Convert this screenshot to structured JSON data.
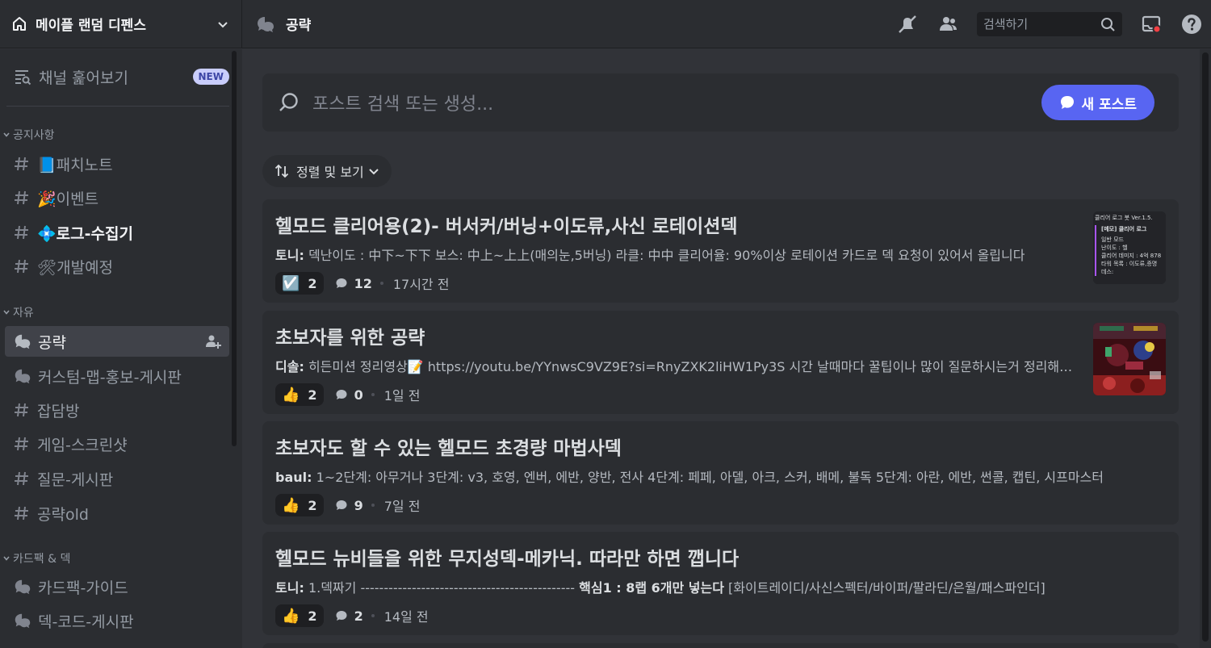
{
  "server": {
    "name": "메이플 랜덤 디펜스"
  },
  "channel": {
    "title": "공략"
  },
  "toolbar": {
    "search_placeholder": "검색하기"
  },
  "sidebar": {
    "browse": {
      "label": "채널 훑어보기",
      "badge": "NEW"
    },
    "categories": [
      {
        "label": "공지사항"
      },
      {
        "label": "자유"
      },
      {
        "label": "카드팩 & 덱"
      }
    ],
    "channels": [
      {
        "label": "📘패치노트"
      },
      {
        "label": "🎉이벤트"
      },
      {
        "label": "💠로그-수집기"
      },
      {
        "label": "🛠개발예정"
      },
      {
        "label": "공략"
      },
      {
        "label": "커스텀-맵-홍보-게시판"
      },
      {
        "label": "잡담방"
      },
      {
        "label": "게임-스크린샷"
      },
      {
        "label": "질문-게시판"
      },
      {
        "label": "공략old"
      },
      {
        "label": "카드팩-가이드"
      },
      {
        "label": "덱-코드-게시판"
      }
    ]
  },
  "main": {
    "search_placeholder": "포스트 검색 또는 생성...",
    "new_post_label": "새 포스트",
    "sort_label": "정렬 및 보기",
    "posts": [
      {
        "title": "헬모드 클리어용(2)- 버서커/버닝+이도류,사신 로테이션덱",
        "author": "토니:",
        "preview": "덱난이도 : 中下~下下 보스: 中上~上上(매의눈,5버닝) 라클: 中中 클리어율: 90%이상 로테이션 카드로 덱 요청이 있어서 올립니다",
        "reaction_emoji": "☑️",
        "reaction_count": "2",
        "message_count": "12",
        "time": "17시간 전",
        "thumb_text": [
          "클리어 로그 봇 Ver.1.5.",
          "[메모] 클리어 로그",
          "일반 모드",
          "난이도 : 헬",
          "클리어 데미지 : 4억 878",
          "타워 목록 : 이도류,증명",
          "데스:"
        ]
      },
      {
        "title": "초보자를 위한 공략",
        "author": "디솔:",
        "preview": "히든미션 정리영상📝 https://youtu.be/YYnwsC9VZ9E?si=RnyZXK2liHW1Py3S 시간 날때마다 꿀팁이나 많이 질문하시는거 정리해볼게요",
        "reaction_emoji": "👍",
        "reaction_count": "2",
        "message_count": "0",
        "time": "1일 전"
      },
      {
        "title": "초보자도 할 수 있는 헬모드 초경량 마법사덱",
        "author": "baul:",
        "preview": "1~2단계: 아무거나 3단계: v3, 호영, 엔버, 에반, 양반, 전사 4단계: 페페, 아델, 아크, 스커, 배메, 불독 5단계: 아란, 에반, 썬콜, 캡틴, 시프마스터",
        "reaction_emoji": "👍",
        "reaction_count": "2",
        "message_count": "9",
        "time": "7일 전"
      },
      {
        "title": "헬모드 뉴비들을 위한 무지성덱-메카닉. 따라만 하면 깹니다",
        "author": "토니:",
        "preview_pre": "1.덱짜기 ---------------------------------------------- ",
        "preview_bold": "핵심1 : 8랩 6개만 넣는다",
        "preview_post": " [화이트레이디/사신스펙터/바이퍼/팔라딘/은월/패스파인더]",
        "reaction_emoji": "👍",
        "reaction_count": "2",
        "message_count": "2",
        "time": "14일 전"
      }
    ]
  }
}
